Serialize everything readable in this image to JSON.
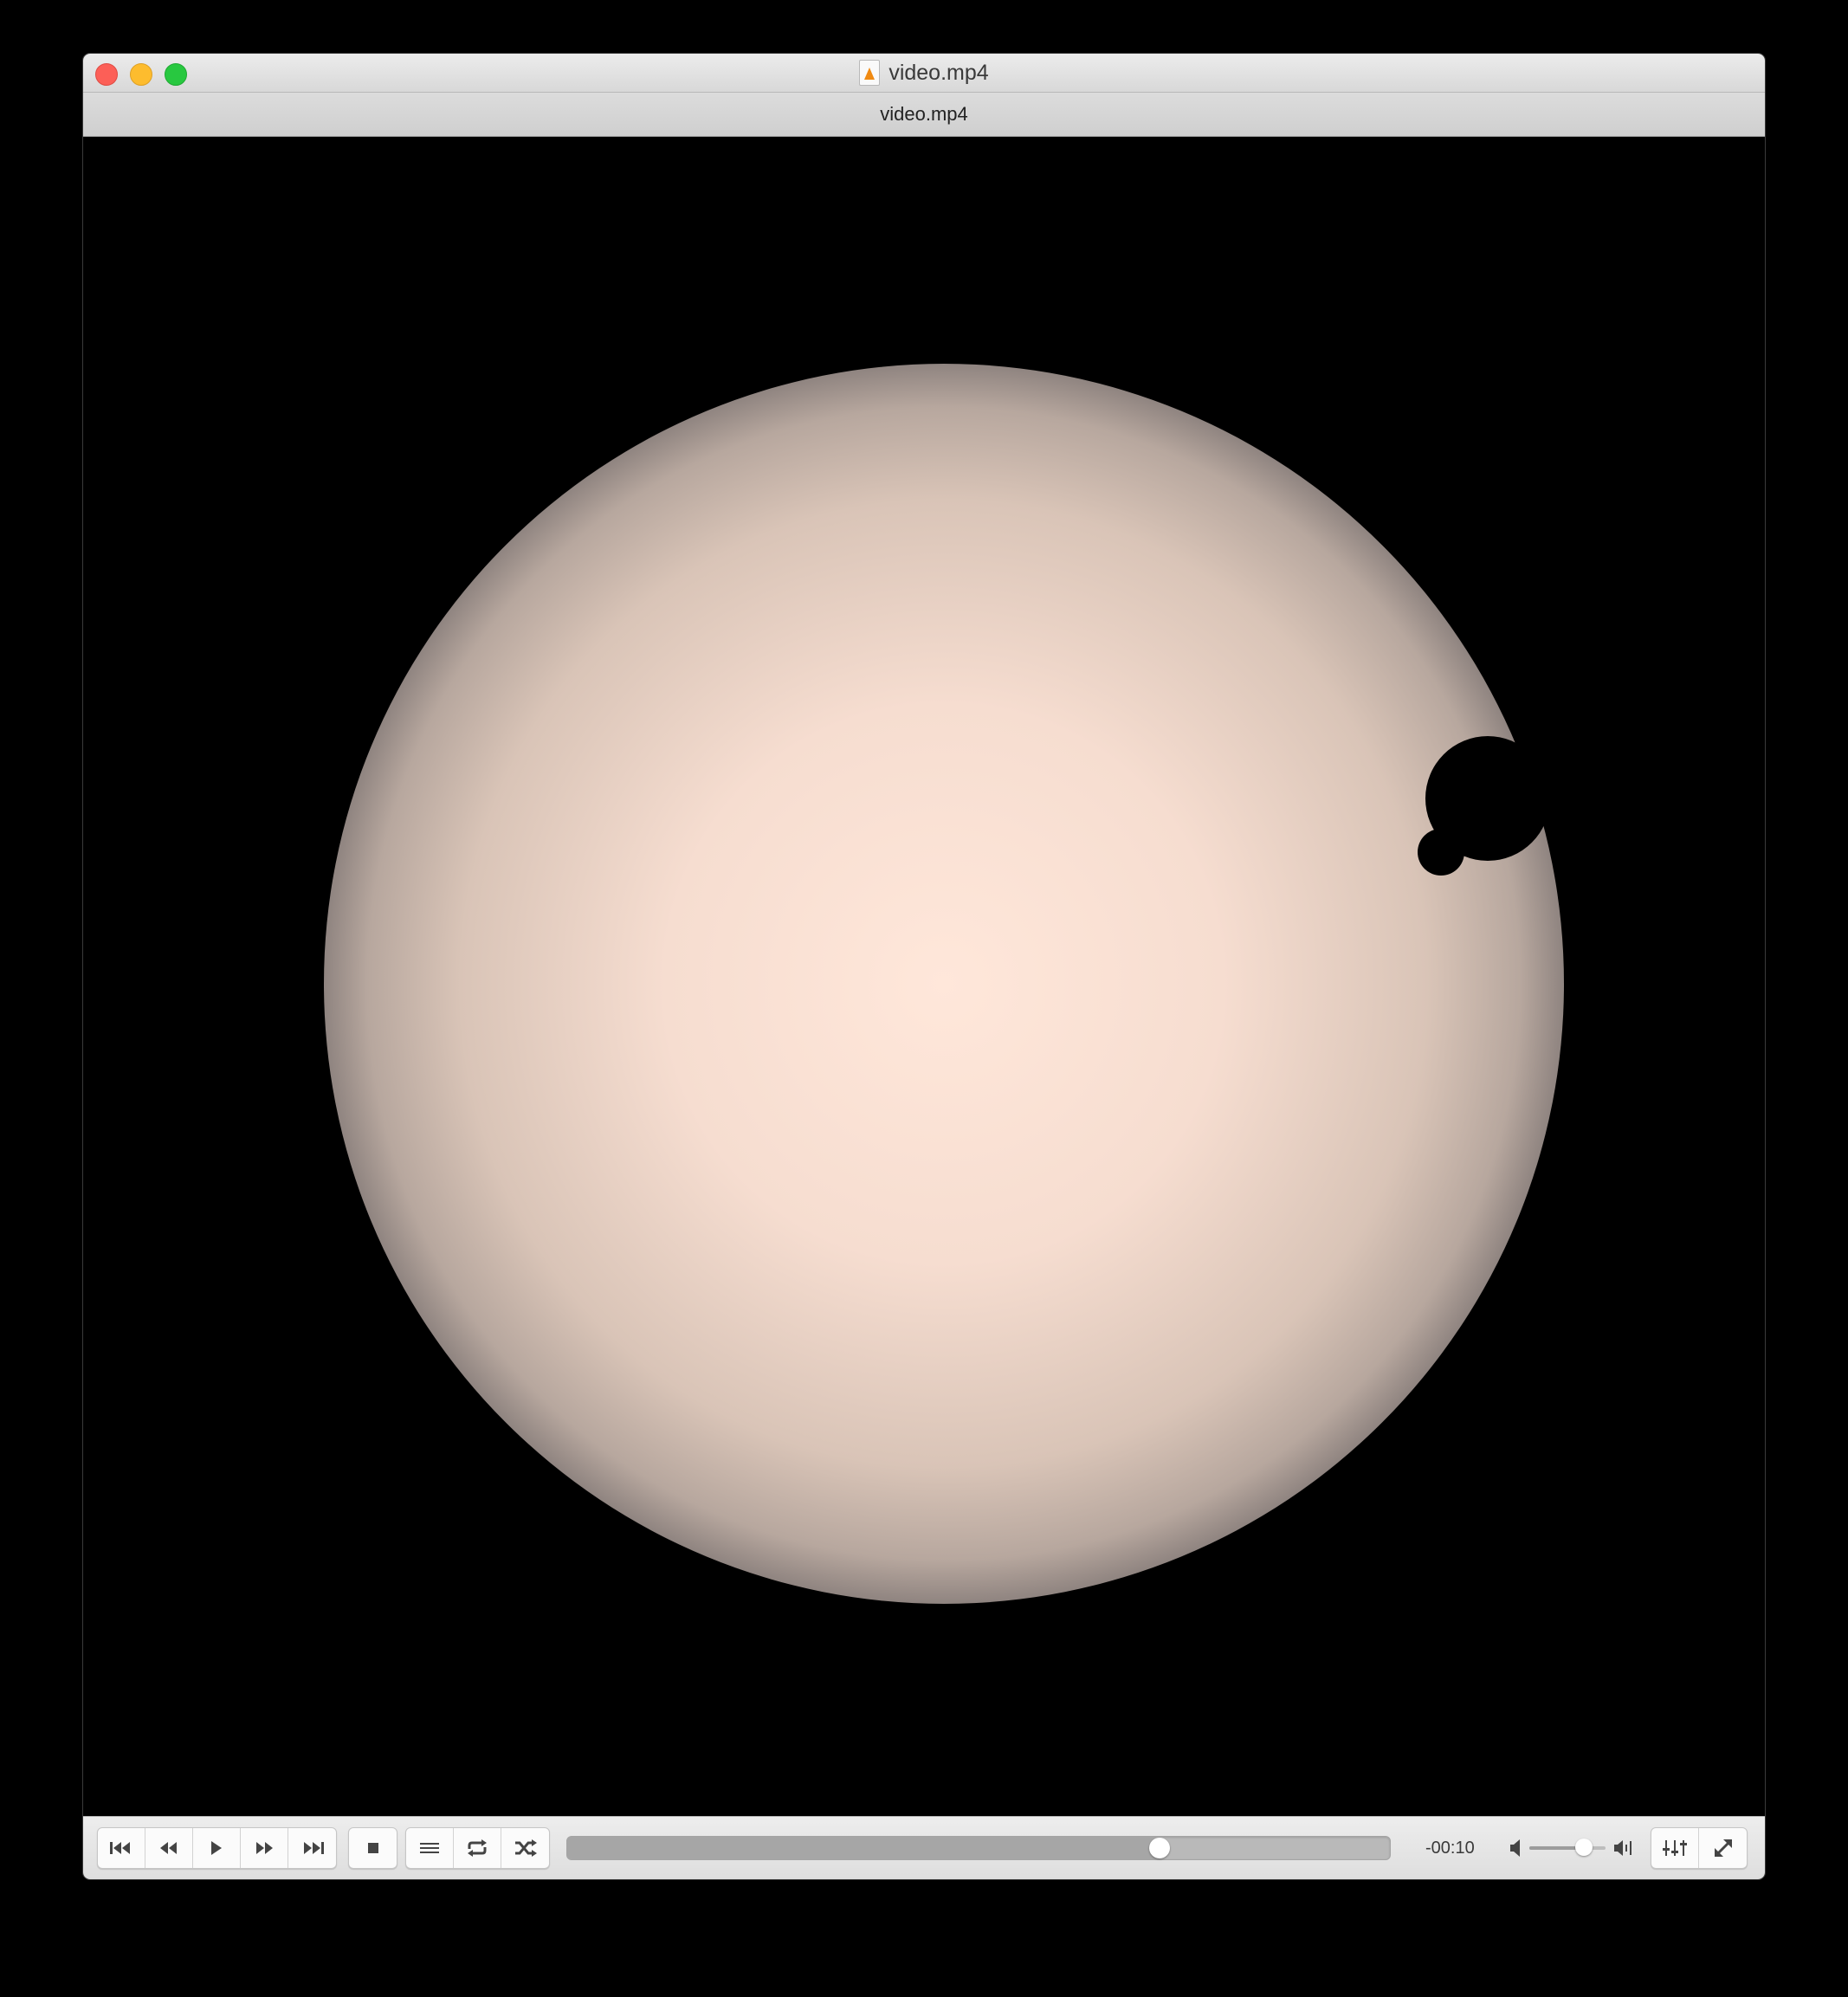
{
  "window": {
    "title": "video.mp4",
    "subtitle": "video.mp4",
    "title_icon": "vlc-document-icon"
  },
  "video": {
    "description_icon": "sun-transit-frame",
    "background_color": "#000000",
    "sun_center_color": "#ffe7da",
    "sun_edge_color": "#8f8480"
  },
  "controls": {
    "transport_buttons": [
      {
        "name": "skip-back",
        "icon": "skip-to-start-icon"
      },
      {
        "name": "rewind",
        "icon": "rewind-icon"
      },
      {
        "name": "play",
        "icon": "play-icon"
      },
      {
        "name": "fast-forward",
        "icon": "fast-forward-icon"
      },
      {
        "name": "skip-forward",
        "icon": "skip-to-end-icon"
      }
    ],
    "stop_icon": "stop-icon",
    "playlist_icons": [
      "playlist-icon",
      "repeat-icon",
      "shuffle-icon"
    ],
    "time_remaining": "-00:10",
    "playback_progress": 0.72,
    "volume_level": 0.72,
    "right_icons": [
      "equalizer-icon",
      "fullscreen-icon"
    ]
  }
}
